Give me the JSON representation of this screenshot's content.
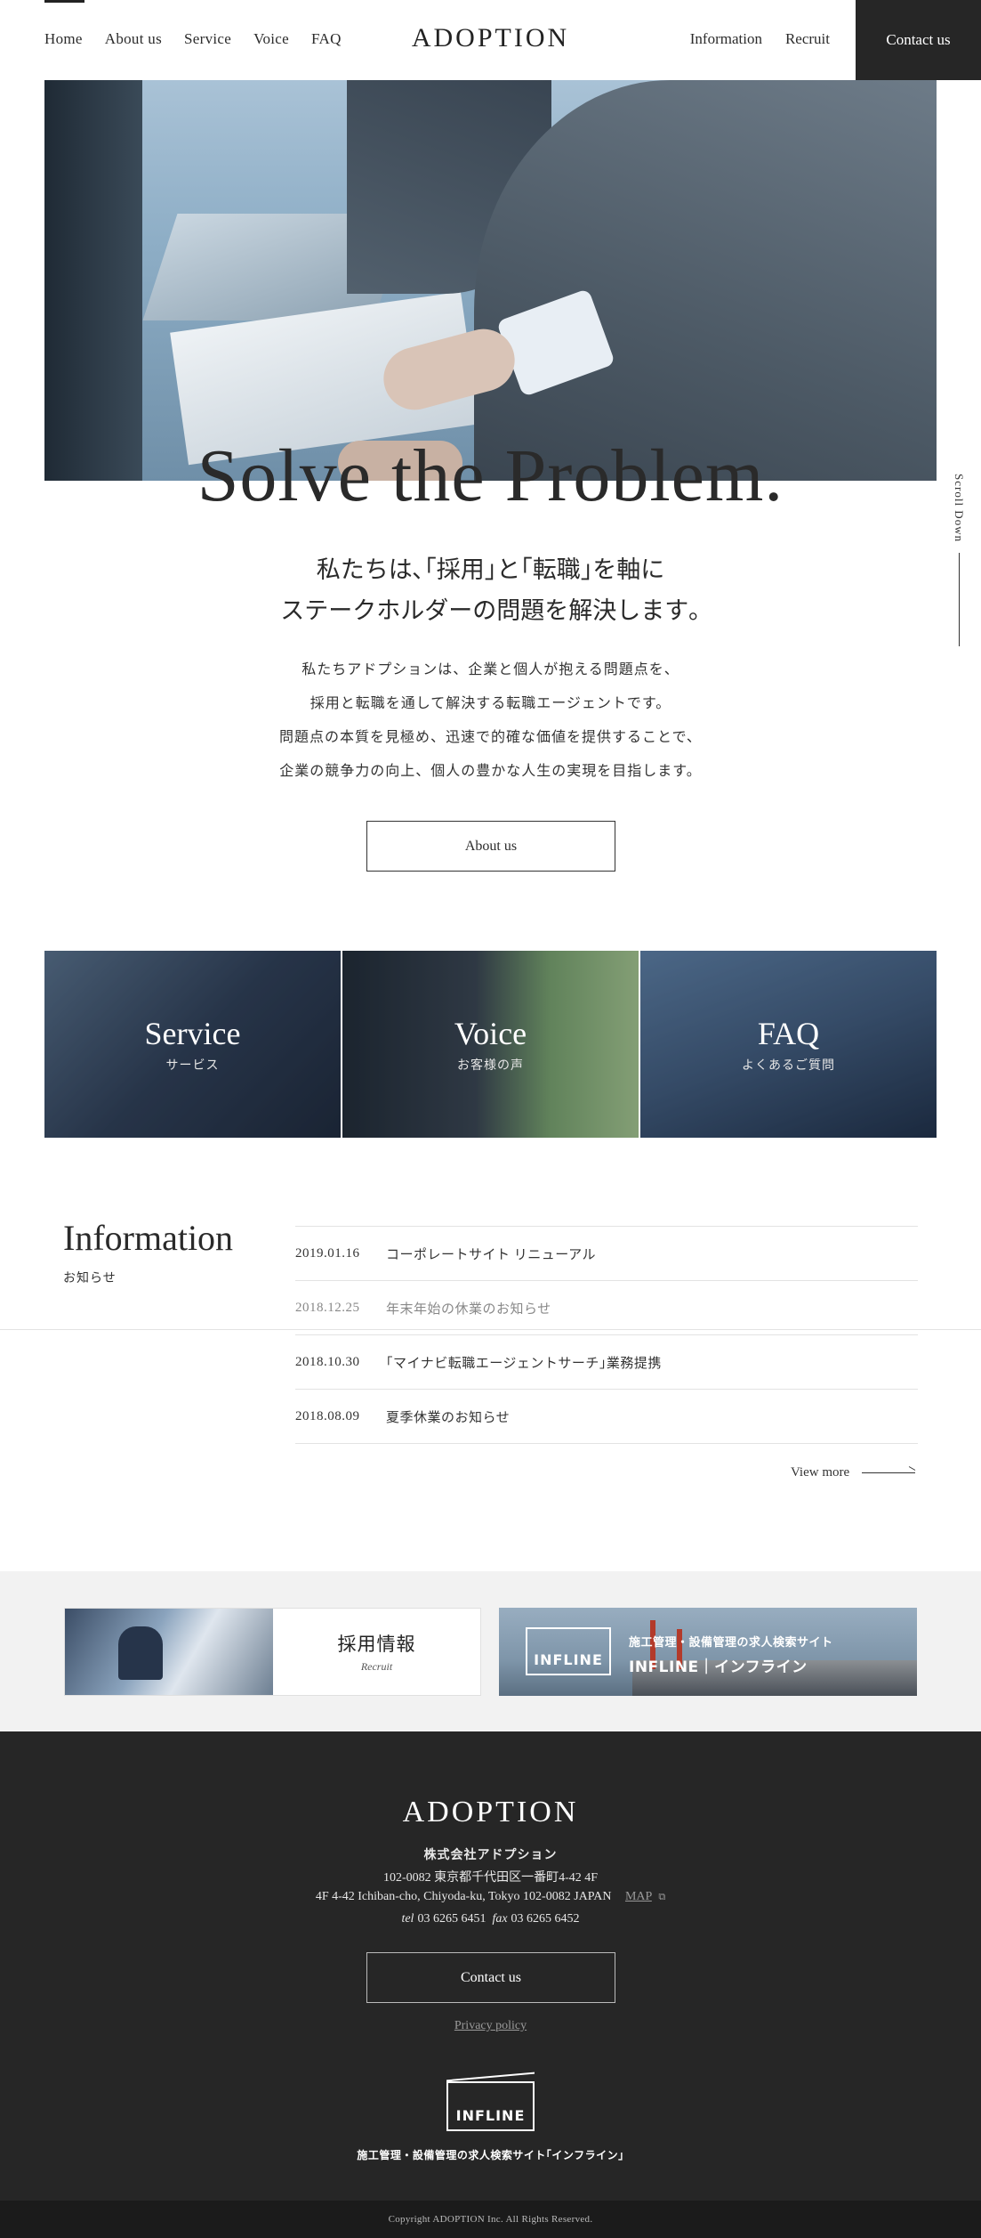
{
  "header": {
    "logo": "ADOPTION",
    "nav_left": [
      "Home",
      "About us",
      "Service",
      "Voice",
      "FAQ"
    ],
    "nav_right": [
      "Information",
      "Recruit"
    ],
    "contact": "Contact us"
  },
  "hero": {
    "title": "Solve the Problem.",
    "scroll_label": "Scroll Down",
    "lead": [
      "私たちは､｢採用｣と｢転職｣を軸に",
      "ステークホルダーの問題を解決します｡"
    ],
    "body": [
      "私たちアドプションは、企業と個人が抱える問題点を、",
      "採用と転職を通して解決する転職エージェントです。",
      "問題点の本質を見極め、迅速で的確な価値を提供することで、",
      "企業の競争力の向上、個人の豊かな人生の実現を目指します。"
    ],
    "about_button": "About us"
  },
  "tiles": [
    {
      "title": "Service",
      "sub": "サービス"
    },
    {
      "title": "Voice",
      "sub": "お客様の声"
    },
    {
      "title": "FAQ",
      "sub": "よくあるご質問"
    }
  ],
  "information": {
    "title": "Information",
    "sub": "お知らせ",
    "items": [
      {
        "date": "2019.01.16",
        "title": "コーポレートサイト リニューアル"
      },
      {
        "date": "2018.12.25",
        "title": "年末年始の休業のお知らせ"
      },
      {
        "date": "2018.10.30",
        "title": "｢マイナビ転職エージェントサーチ｣業務提携"
      },
      {
        "date": "2018.08.09",
        "title": "夏季休業のお知らせ"
      }
    ],
    "view_more": "View more"
  },
  "banners": {
    "recruit_jp": "採用情報",
    "recruit_en": "Recruit",
    "infline_logo": "INFLINE",
    "infline_t1": "施工管理・設備管理の求人検索サイト",
    "infline_t2": "INFLINE｜インフライン"
  },
  "footer": {
    "logo": "ADOPTION",
    "company": "株式会社アドプション",
    "addr_jp": "102-0082 東京都千代田区一番町4-42 4F",
    "addr_en": "4F 4-42 Ichiban-cho, Chiyoda-ku, Tokyo 102-0082 JAPAN",
    "map": "MAP",
    "tel_label": "tel",
    "tel": "03 6265 6451",
    "fax_label": "fax",
    "fax": "03 6265 6452",
    "contact": "Contact us",
    "privacy": "Privacy policy",
    "infline_logo": "INFLINE",
    "infline_text": "施工管理・設備管理の求人検索サイト｢インフライン｣",
    "copyright": "Copyright ADOPTION Inc. All Rights Reserved."
  }
}
